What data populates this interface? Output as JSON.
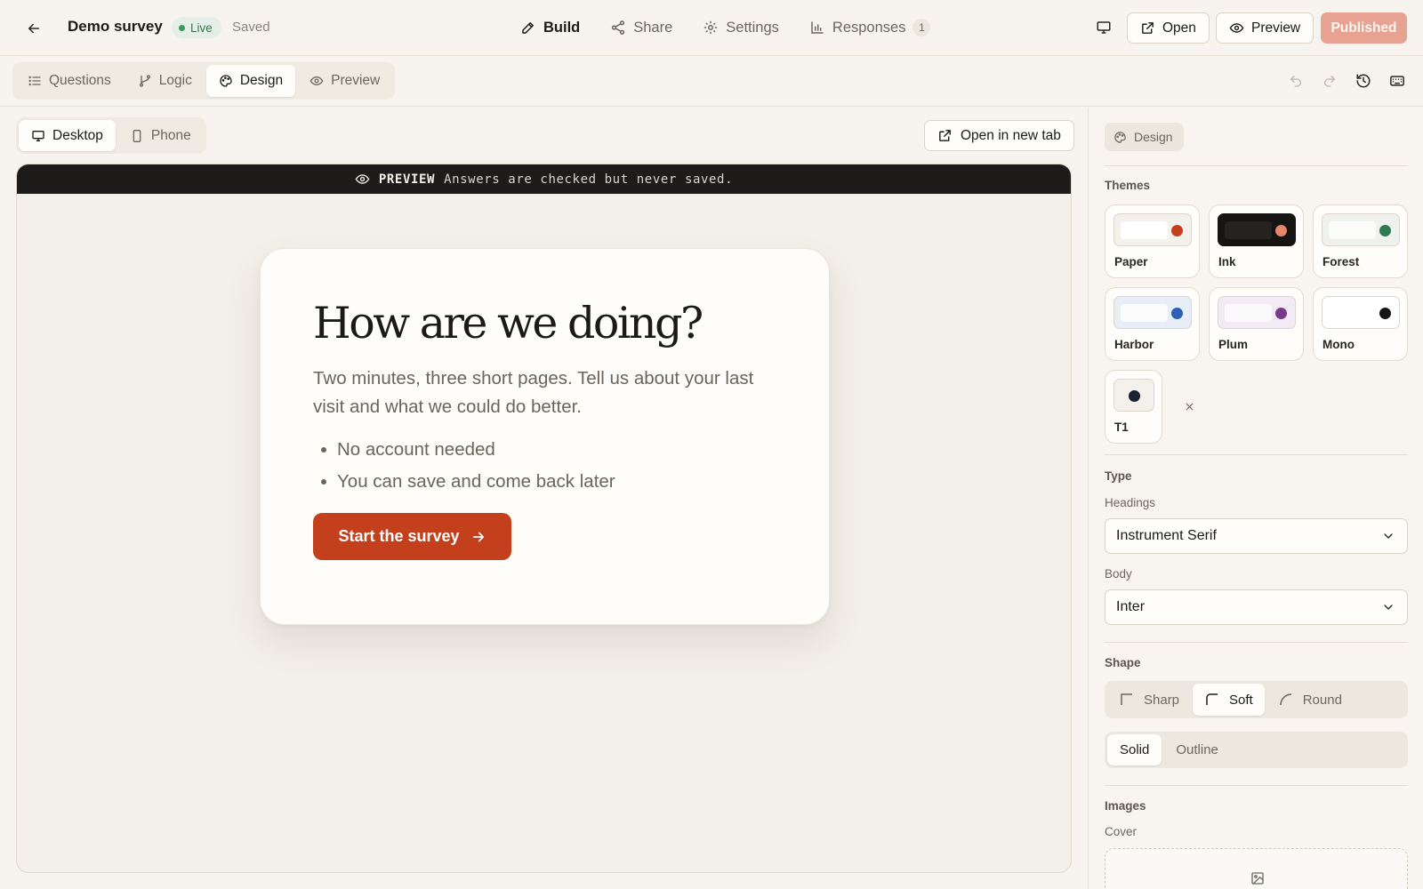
{
  "header": {
    "title": "Demo survey",
    "status_badge": "Live",
    "save_state": "Saved",
    "nav": [
      {
        "label": "Build",
        "icon": "pencil-icon",
        "active": true
      },
      {
        "label": "Share",
        "icon": "share-icon",
        "active": false
      },
      {
        "label": "Settings",
        "icon": "gear-icon",
        "active": false
      },
      {
        "label": "Responses",
        "icon": "bar-chart-icon",
        "active": false,
        "count": "1"
      }
    ],
    "open_label": "Open",
    "preview_label": "Preview",
    "published_label": "Published"
  },
  "subbar": {
    "tabs": [
      {
        "label": "Questions",
        "icon": "list-icon"
      },
      {
        "label": "Logic",
        "icon": "branch-icon"
      },
      {
        "label": "Design",
        "icon": "palette-icon"
      },
      {
        "label": "Preview",
        "icon": "eye-icon"
      }
    ],
    "active_tab": "Design"
  },
  "preview": {
    "devices": [
      {
        "label": "Desktop",
        "icon": "monitor-icon"
      },
      {
        "label": "Phone",
        "icon": "phone-icon"
      }
    ],
    "active_device": "Desktop",
    "open_new_tab_label": "Open in new tab",
    "banner_tag": "PREVIEW",
    "banner_text": "Answers are checked but never saved.",
    "survey": {
      "title": "How are we doing?",
      "description": "Two minutes, three short pages. Tell us about your last visit and what we could do better.",
      "bullets": [
        "No account needed",
        "You can save and come back later"
      ],
      "start_label": "Start the survey"
    }
  },
  "panel": {
    "chip_label": "Design",
    "themes_label": "Themes",
    "themes": [
      {
        "name": "Paper",
        "swatch_bg": "#f4f1ec",
        "bar": "#ffffff",
        "dot": "#c4401d"
      },
      {
        "name": "Ink",
        "swatch_bg": "#151413",
        "bar": "#242321",
        "dot": "#e8866a"
      },
      {
        "name": "Forest",
        "swatch_bg": "#eef1ec",
        "bar": "#fbfcfa",
        "dot": "#2f7a52"
      },
      {
        "name": "Harbor",
        "swatch_bg": "#e7eef8",
        "bar": "#fbfcfe",
        "dot": "#2b5fb8"
      },
      {
        "name": "Plum",
        "swatch_bg": "#f2eaf4",
        "bar": "#fcf9fd",
        "dot": "#7a3a8c"
      },
      {
        "name": "Mono",
        "swatch_bg": "#ffffff",
        "bar": "#ffffff",
        "dot": "#161616"
      },
      {
        "name": "T1",
        "swatch_bg": "#f4f1ec",
        "bar": "#f4f1ec",
        "dot": "#1b2233"
      }
    ],
    "type_label": "Type",
    "headings_label": "Headings",
    "headings_value": "Instrument Serif",
    "body_label": "Body",
    "body_value": "Inter",
    "shape_label": "Shape",
    "shapes": [
      "Sharp",
      "Soft",
      "Round"
    ],
    "active_shape": "Soft",
    "fills": [
      "Solid",
      "Outline"
    ],
    "active_fill": "Solid",
    "images_label": "Images",
    "cover_label": "Cover"
  },
  "colors": {
    "accent": "#c4401d",
    "published_bg": "#e8a291",
    "live_green": "#2f7a4e"
  }
}
